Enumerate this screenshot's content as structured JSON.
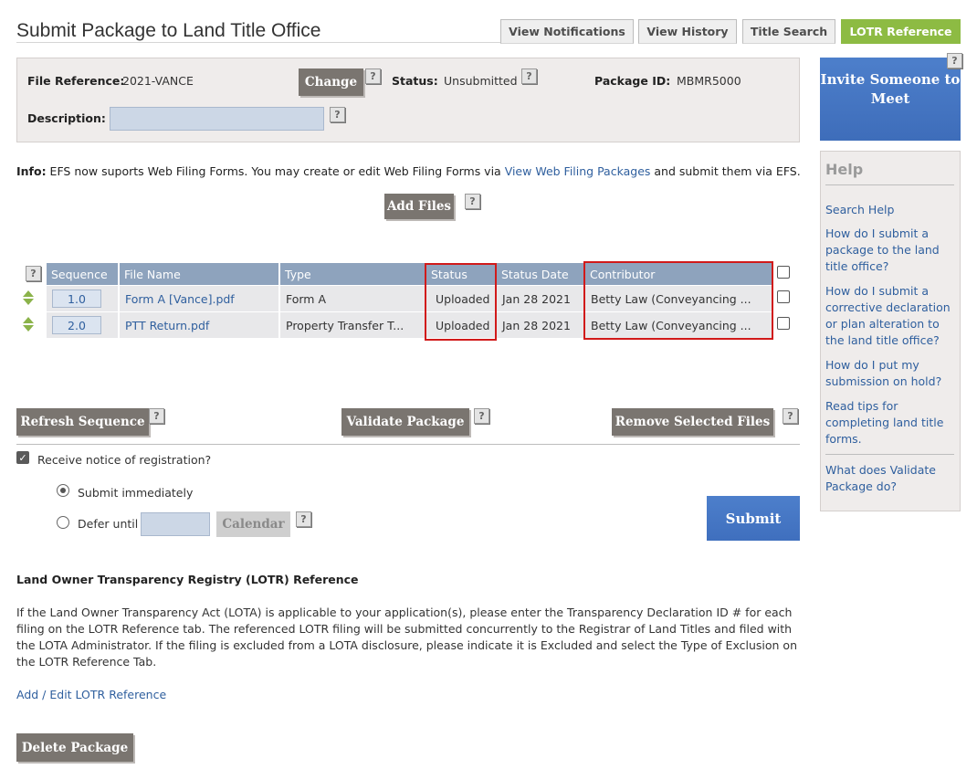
{
  "header": {
    "title": "Submit Package to Land Title Office",
    "tabs": [
      "View Notifications",
      "View History",
      "Title Search",
      "LOTR Reference"
    ],
    "active_tab": "LOTR Reference"
  },
  "package": {
    "file_reference_label": "File Reference:",
    "file_reference": "2021-VANCE",
    "change_label": "Change",
    "status_label": "Status:",
    "status": "Unsubmitted",
    "package_id_label": "Package ID:",
    "package_id": "MBMR5000",
    "description_label": "Description:",
    "description_value": ""
  },
  "info": {
    "prefix": "Info:",
    "text_before": " EFS now suports Web Filing Forms. You may create or edit Web Filing Forms via ",
    "link": "View Web Filing Packages",
    "text_after": " and submit them via EFS."
  },
  "add_files_label": "Add Files",
  "help_glyph": "?",
  "table": {
    "headers": [
      "Sequence",
      "File Name",
      "Type",
      "Status",
      "Status Date",
      "Contributor"
    ],
    "rows": [
      {
        "sequence": "1.0",
        "file_name": "Form A [Vance].pdf",
        "type": "Form A",
        "status": "Uploaded",
        "status_date": "Jan 28 2021",
        "contributor": "Betty Law (Conveyancing ..."
      },
      {
        "sequence": "2.0",
        "file_name": "PTT Return.pdf",
        "type": "Property Transfer T...",
        "status": "Uploaded",
        "status_date": "Jan 28 2021",
        "contributor": "Betty Law (Conveyancing ..."
      }
    ]
  },
  "actions": {
    "refresh": "Refresh Sequence",
    "validate": "Validate Package",
    "remove": "Remove Selected Files"
  },
  "notice": {
    "label": "Receive notice of registration?",
    "checked": true
  },
  "submit_options": {
    "immediately": "Submit immediately",
    "defer": "Defer until",
    "calendar": "Calendar",
    "selected": "immediately",
    "submit": "Submit"
  },
  "lotr": {
    "heading": "Land Owner Transparency Registry (LOTR) Reference",
    "paragraph": "If the Land Owner Transparency Act (LOTA) is applicable to your application(s), please enter the Transparency Declaration ID # for each filing on the LOTR Reference tab. The referenced LOTR filing will be submitted concurrently to the Registrar of Land Titles and filed with the LOTA Administrator. If the filing is excluded from a LOTA disclosure, please indicate it is Excluded and select the Type of Exclusion on the LOTR Reference Tab.",
    "link": "Add / Edit LOTR Reference"
  },
  "delete_label": "Delete Package",
  "sidebar": {
    "invite": "Invite Someone to Meet",
    "help_title": "Help",
    "links": [
      "Search Help",
      "How do I submit a package to the land title office?",
      "How do I submit a corrective declaration or plan alteration to the land title office?",
      "How do I put my submission on hold?",
      "Read tips for completing land title forms.",
      "What does Validate Package do?"
    ]
  },
  "colors": {
    "active_tab": "#8dbb43",
    "table_header": "#8ea3bd",
    "primary_button": "#4372c0",
    "gray_button": "#7a7570",
    "highlight_box": "#d11a1a"
  }
}
